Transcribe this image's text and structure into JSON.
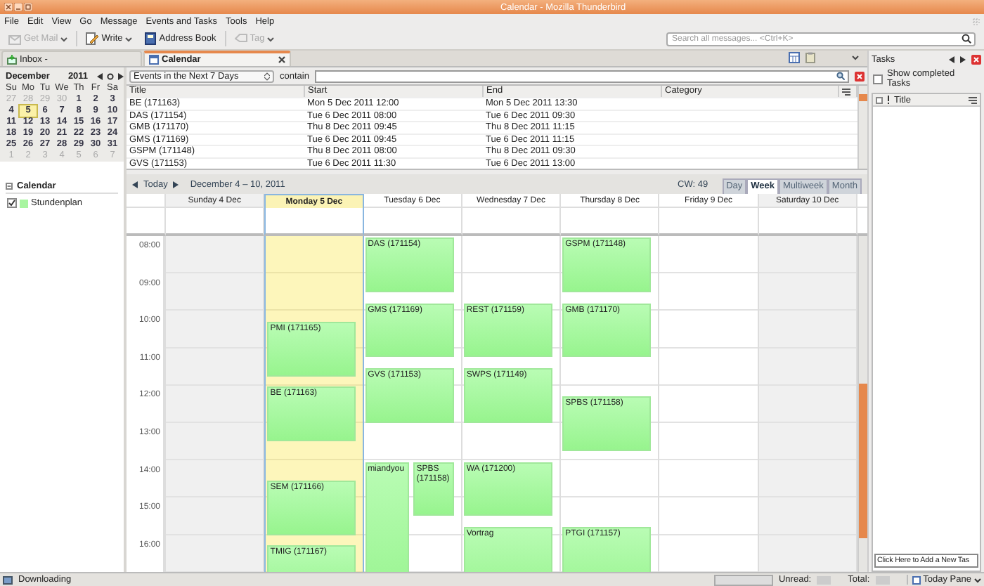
{
  "window": {
    "title": "Calendar - Mozilla Thunderbird"
  },
  "menu": [
    "File",
    "Edit",
    "View",
    "Go",
    "Message",
    "Events and Tasks",
    "Tools",
    "Help"
  ],
  "toolbar": {
    "buttons": [
      {
        "kind": "getmail",
        "label": "Get Mail",
        "disabled": true
      },
      {
        "kind": "write",
        "label": "Write",
        "disabled": false
      },
      {
        "kind": "addressbook",
        "label": "Address Book",
        "disabled": false
      },
      {
        "kind": "tag",
        "label": "Tag",
        "disabled": true
      }
    ],
    "search": {
      "placeholder": "Search all messages... <Ctrl+K>"
    }
  },
  "tabs": [
    {
      "kind": "mail",
      "label": "Inbox -",
      "selected": false
    },
    {
      "kind": "calendar",
      "label": "Calendar",
      "selected": true
    }
  ],
  "mini_calendar": {
    "month": "December",
    "year": "2011",
    "weekdays": [
      "Su",
      "Mo",
      "Tu",
      "We",
      "Th",
      "Fr",
      "Sa"
    ],
    "weeks": [
      [
        {
          "day": "27",
          "other_month": true,
          "selected": false
        },
        {
          "day": "28",
          "other_month": true,
          "selected": false
        },
        {
          "day": "29",
          "other_month": true,
          "selected": false
        },
        {
          "day": "30",
          "other_month": true,
          "selected": false
        },
        {
          "day": "1",
          "other_month": false,
          "selected": false
        },
        {
          "day": "2",
          "other_month": false,
          "selected": false
        },
        {
          "day": "3",
          "other_month": false,
          "selected": false
        }
      ],
      [
        {
          "day": "4",
          "other_month": false,
          "selected": false
        },
        {
          "day": "5",
          "other_month": false,
          "selected": true
        },
        {
          "day": "6",
          "other_month": false,
          "selected": false
        },
        {
          "day": "7",
          "other_month": false,
          "selected": false
        },
        {
          "day": "8",
          "other_month": false,
          "selected": false
        },
        {
          "day": "9",
          "other_month": false,
          "selected": false
        },
        {
          "day": "10",
          "other_month": false,
          "selected": false
        }
      ],
      [
        {
          "day": "11",
          "other_month": false,
          "selected": false
        },
        {
          "day": "12",
          "other_month": false,
          "selected": false
        },
        {
          "day": "13",
          "other_month": false,
          "selected": false
        },
        {
          "day": "14",
          "other_month": false,
          "selected": false
        },
        {
          "day": "15",
          "other_month": false,
          "selected": false
        },
        {
          "day": "16",
          "other_month": false,
          "selected": false
        },
        {
          "day": "17",
          "other_month": false,
          "selected": false
        }
      ],
      [
        {
          "day": "18",
          "other_month": false,
          "selected": false
        },
        {
          "day": "19",
          "other_month": false,
          "selected": false
        },
        {
          "day": "20",
          "other_month": false,
          "selected": false
        },
        {
          "day": "21",
          "other_month": false,
          "selected": false
        },
        {
          "day": "22",
          "other_month": false,
          "selected": false
        },
        {
          "day": "23",
          "other_month": false,
          "selected": false
        },
        {
          "day": "24",
          "other_month": false,
          "selected": false
        }
      ],
      [
        {
          "day": "25",
          "other_month": false,
          "selected": false
        },
        {
          "day": "26",
          "other_month": false,
          "selected": false
        },
        {
          "day": "27",
          "other_month": false,
          "selected": false
        },
        {
          "day": "28",
          "other_month": false,
          "selected": false
        },
        {
          "day": "29",
          "other_month": false,
          "selected": false
        },
        {
          "day": "30",
          "other_month": false,
          "selected": false
        },
        {
          "day": "31",
          "other_month": false,
          "selected": false
        }
      ],
      [
        {
          "day": "1",
          "other_month": true,
          "selected": false
        },
        {
          "day": "2",
          "other_month": true,
          "selected": false
        },
        {
          "day": "3",
          "other_month": true,
          "selected": false
        },
        {
          "day": "4",
          "other_month": true,
          "selected": false
        },
        {
          "day": "5",
          "other_month": true,
          "selected": false
        },
        {
          "day": "6",
          "other_month": true,
          "selected": false
        },
        {
          "day": "7",
          "other_month": true,
          "selected": false
        }
      ]
    ]
  },
  "calendars": {
    "header": "Calendar",
    "items": [
      {
        "name": "Stundenplan",
        "checked": true
      }
    ]
  },
  "filter": {
    "range": "Events in the Next 7 Days",
    "label": "contain"
  },
  "event_list": {
    "columns": [
      "Title",
      "Start",
      "End",
      "Category"
    ],
    "rows": [
      {
        "title": "BE (171163)",
        "start": "Mon 5 Dec 2011 12:00",
        "end": "Mon 5 Dec 2011 13:30"
      },
      {
        "title": "DAS (171154)",
        "start": "Tue 6 Dec 2011 08:00",
        "end": "Tue 6 Dec 2011 09:30"
      },
      {
        "title": "GMB (171170)",
        "start": "Thu 8 Dec 2011 09:45",
        "end": "Thu 8 Dec 2011 11:15"
      },
      {
        "title": "GMS (171169)",
        "start": "Tue 6 Dec 2011 09:45",
        "end": "Tue 6 Dec 2011 11:15"
      },
      {
        "title": "GSPM (171148)",
        "start": "Thu 8 Dec 2011 08:00",
        "end": "Thu 8 Dec 2011 09:30"
      },
      {
        "title": "GVS (171153)",
        "start": "Tue 6 Dec 2011 11:30",
        "end": "Tue 6 Dec 2011 13:00"
      }
    ]
  },
  "week_view": {
    "today": "Today",
    "range": "December 4 – 10, 2011",
    "week_label": "CW: 49",
    "views": [
      {
        "label": "Day",
        "selected": false
      },
      {
        "label": "Week",
        "selected": true
      },
      {
        "label": "Multiweek",
        "selected": false
      },
      {
        "label": "Month",
        "selected": false
      }
    ],
    "hours": [
      "08:00",
      "09:00",
      "10:00",
      "11:00",
      "12:00",
      "13:00",
      "14:00",
      "15:00",
      "16:00"
    ],
    "days": [
      {
        "label": "Sunday 4 Dec",
        "weekend": true,
        "today": false
      },
      {
        "label": "Monday 5 Dec",
        "weekend": false,
        "today": true,
        "events": [
          "PMI (171165)",
          "BE (171163)",
          "SEM (171166)",
          "TMIG (171167)"
        ]
      },
      {
        "label": "Tuesday 6 Dec",
        "weekend": false,
        "today": false,
        "events": [
          "DAS (171154)",
          "GMS (171169)",
          "GVS (171153)",
          "miandyou",
          "SPBS (171158)"
        ]
      },
      {
        "label": "Wednesday 7 Dec",
        "weekend": false,
        "today": false,
        "events": [
          "REST (171159)",
          "SWPS (171149)",
          "WA (171200)",
          "Vortrag"
        ]
      },
      {
        "label": "Thursday 8 Dec",
        "weekend": false,
        "today": false,
        "events": [
          "GSPM (171148)",
          "GMB (171170)",
          "SPBS (171158)",
          "PTGI (171157)"
        ]
      },
      {
        "label": "Friday 9 Dec",
        "weekend": false,
        "today": false
      },
      {
        "label": "Saturday 10 Dec",
        "weekend": true,
        "today": false
      }
    ]
  },
  "tasks": {
    "title": "Tasks",
    "show_completed": {
      "label": "Show completed Tasks",
      "checked": false
    },
    "column": "Title",
    "new_task": "Click Here to Add a New Tas"
  },
  "status_bar": {
    "activity": "Downloading",
    "unread": "Unread:",
    "total": "Total:",
    "today_pane": "Today Pane"
  }
}
